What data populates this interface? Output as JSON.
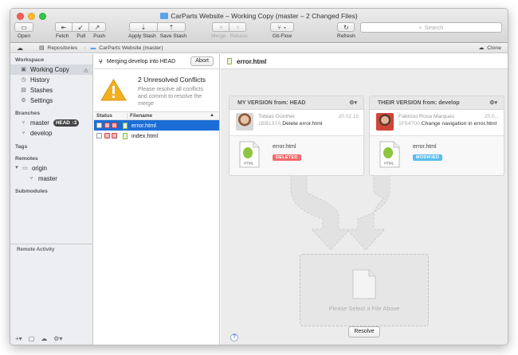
{
  "window": {
    "title": "CarParts Website – Working Copy (master – 2 Changed Files)"
  },
  "toolbar": {
    "open": "Open",
    "fetch": "Fetch",
    "pull": "Pull",
    "push": "Push",
    "apply_stash": "Apply Stash",
    "save_stash": "Save Stash",
    "merge": "Merge",
    "rebase": "Rebase",
    "gitflow": "Git-Flow",
    "refresh": "Refresh",
    "search_placeholder": "Search"
  },
  "pathbar": {
    "repositories": "Repositories",
    "repo": "CarParts Website (master)",
    "clone": "Clone"
  },
  "sidebar": {
    "workspace_header": "Workspace",
    "workspace_items": [
      "Working Copy",
      "History",
      "Stashes",
      "Settings"
    ],
    "branches_header": "Branches",
    "branches": [
      {
        "name": "master",
        "badge": "HEAD",
        "count": "3"
      },
      {
        "name": "develop"
      }
    ],
    "tags_header": "Tags",
    "remotes_header": "Remotes",
    "remote": {
      "name": "origin",
      "branch": "master"
    },
    "submodules_header": "Submodules",
    "remote_activity": "Remote Activity"
  },
  "mergebar": {
    "text": "Merging develop into HEAD",
    "abort": "Abort"
  },
  "conflicts": {
    "title": "2 Unresolved Conflicts",
    "subtitle": "Please resolve all conflicts and commit to resolve the merge"
  },
  "filelist": {
    "col_status": "Status",
    "col_filename": "Filename",
    "files": [
      {
        "name": "error.html"
      },
      {
        "name": "index.html"
      }
    ]
  },
  "main": {
    "file_title": "error.html",
    "my_version": {
      "title": "MY VERSION from: HEAD",
      "author": "Tobias Günther",
      "date": "20.02.15",
      "hash": "1BB137A",
      "message": "Delete error.html",
      "file": "error.html",
      "status": "DELETED",
      "status_color": "#f36b6b"
    },
    "their_version": {
      "title": "THEIR VERSION from: develop",
      "author": "Fabricio Rosa Marques",
      "date": "20.0...",
      "hash": "1F54700",
      "message": "Change navigation in error.html",
      "file": "error.html",
      "status": "MODIFIED",
      "status_color": "#5bbcec"
    },
    "drop_text": "Please Select a File Above",
    "resolve": "Resolve",
    "help": "?"
  }
}
